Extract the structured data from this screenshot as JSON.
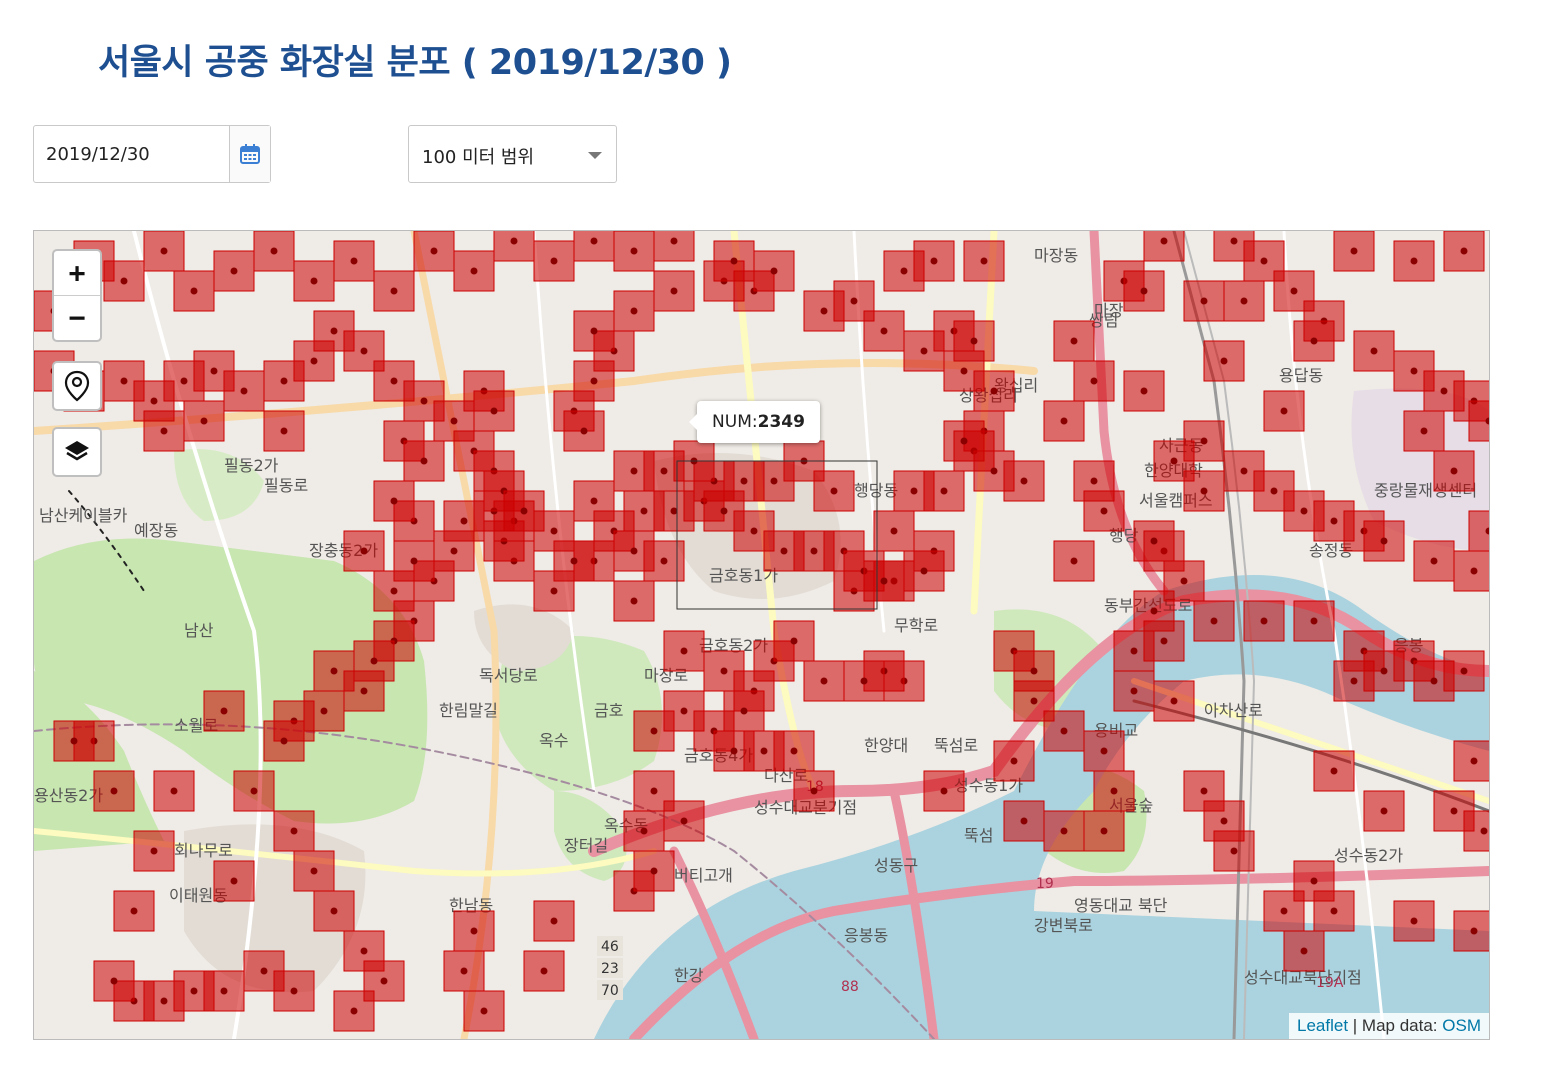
{
  "title": "서울시 공중 화장실 분포 ( 2019/12/30 )",
  "date_input": {
    "value": "2019/12/30"
  },
  "range_select": {
    "selected": "100 미터 범위"
  },
  "map": {
    "zoom_in_label": "+",
    "zoom_out_label": "−",
    "tooltip": {
      "label": "NUM:",
      "value": "2349"
    },
    "attribution": {
      "leaflet": "Leaflet",
      "separator": " | Map data: ",
      "osm": "OSM"
    },
    "place_labels": [
      "마장동",
      "필동2가",
      "예장동",
      "장충동2가",
      "남산",
      "용산동2가",
      "이태원동",
      "한남동",
      "옥수동",
      "금호동1가",
      "금호동2가",
      "금호동4가",
      "행당동",
      "사근동",
      "한양대학",
      "서울캠퍼스",
      "중랑물재생센터",
      "송정동",
      "용답동",
      "성수동1가",
      "성수동2가",
      "서울숲",
      "왕십리",
      "응봉동",
      "금호",
      "남산케이블카",
      "한강",
      "마장로",
      "장터길",
      "한림말길",
      "버티고개",
      "옥수",
      "독서당로",
      "다산로",
      "성수대교분기점",
      "성수대교북단기점",
      "영동대교 북단",
      "강변북로",
      "동부간선도로",
      "아차산로",
      "성동구",
      "무학로",
      "회나무로",
      "소월로",
      "필동로",
      "마장",
      "뚝섬로",
      "뚝섬",
      "상왕십리",
      "쌍림",
      "응봉",
      "행당",
      "한양대",
      "용비교"
    ],
    "road_badges": [
      "46",
      "23",
      "70",
      "88",
      "18",
      "19",
      "19A"
    ],
    "marker_color": "#cc0000"
  }
}
